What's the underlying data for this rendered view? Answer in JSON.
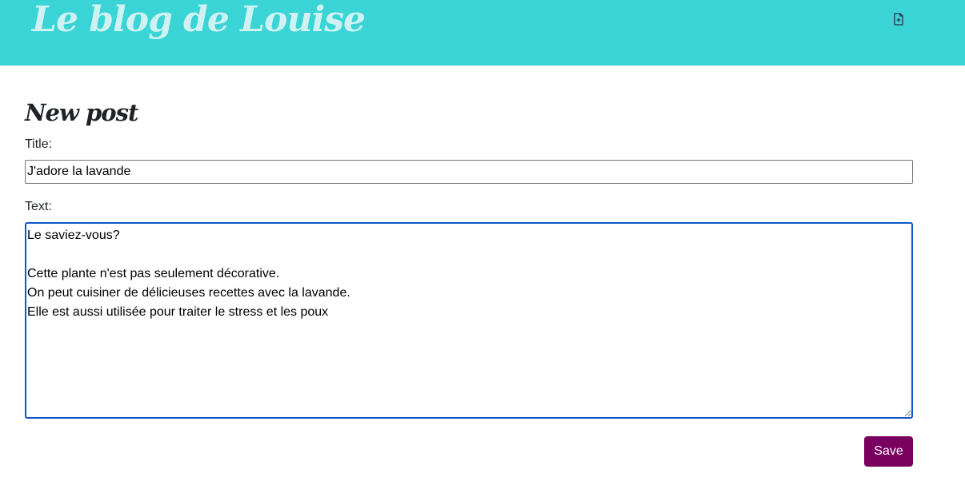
{
  "header": {
    "site_title": "Le blog de Louise",
    "background_color": "#3ad4d6",
    "new_post_icon": "file-plus-icon"
  },
  "main": {
    "heading": "New post",
    "form": {
      "title_label": "Title:",
      "title_value": "J'adore la lavande",
      "text_label": "Text:",
      "text_value": "Le saviez-vous?\n\nCette plante n'est pas seulement décorative.\nOn peut cuisiner de délicieuses recettes avec la lavande.\nElle est aussi utilisée pour traiter le stress et les poux",
      "save_label": "Save",
      "save_color": "#7a005f"
    }
  }
}
